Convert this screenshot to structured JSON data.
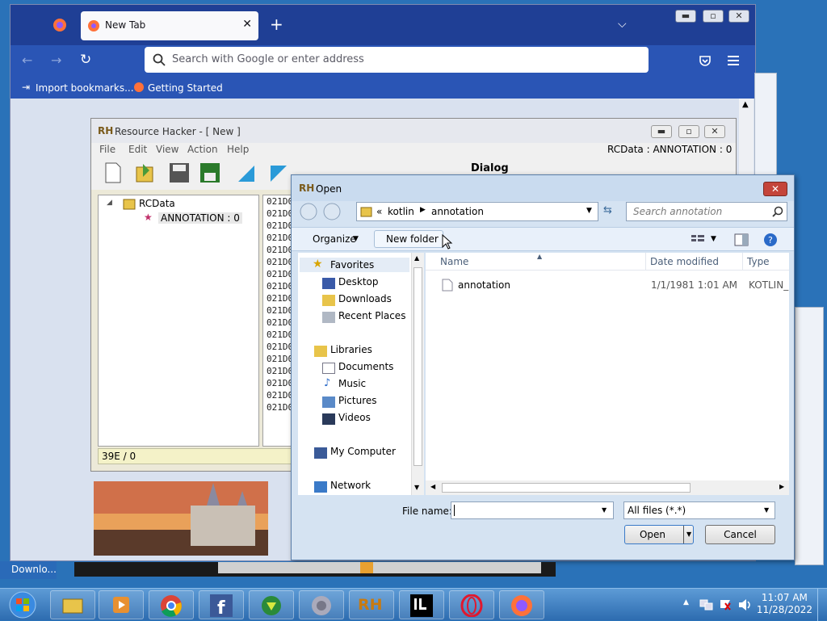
{
  "firefox": {
    "tab_title": "New Tab",
    "tab_close": "✕",
    "new_tab": "+",
    "url_placeholder": "Search with Google or enter address",
    "bookmarks": [
      "Import bookmarks...",
      "Getting Started"
    ]
  },
  "resource_hacker": {
    "title": "Resource Hacker - [ New ]",
    "menu": [
      "File",
      "Edit",
      "View",
      "Action",
      "Help"
    ],
    "status_right": "RCData : ANNOTATION : 0",
    "toolbar_dialog_label": "Dialog",
    "tree": {
      "root": "RCData",
      "child": "ANNOTATION : 0"
    },
    "hex_rows": [
      "021D0",
      "021D0",
      "021D0",
      "021D0",
      "021D0",
      "021D0",
      "021D0",
      "021D0",
      "021D0",
      "021D0",
      "021D0",
      "021D0",
      "021D0",
      "021D0",
      "021D0",
      "021D0",
      "021D0",
      "021D0"
    ],
    "status": "39E / 0"
  },
  "open_dialog": {
    "title": "Open",
    "breadcrumb": [
      "«",
      "kotlin",
      "annotation"
    ],
    "search_placeholder": "Search annotation",
    "organize": "Organize",
    "new_folder": "New folder",
    "nav": {
      "favorites": "Favorites",
      "favorites_items": [
        "Desktop",
        "Downloads",
        "Recent Places"
      ],
      "libraries": "Libraries",
      "libraries_items": [
        "Documents",
        "Music",
        "Pictures",
        "Videos"
      ],
      "computer": "My Computer",
      "network": "Network"
    },
    "columns": [
      "Name",
      "Date modified",
      "Type"
    ],
    "files": [
      {
        "name": "annotation",
        "date": "1/1/1981 1:01 AM",
        "type": "KOTLIN_E"
      }
    ],
    "file_name_label": "File name:",
    "file_name_value": "",
    "filter": "All files (*.*)",
    "open_btn": "Open",
    "cancel_btn": "Cancel"
  },
  "desktop": {
    "download_label": "Downlo..."
  },
  "taskbar": {
    "time": "11:07 AM",
    "date": "11/28/2022"
  },
  "colors": {
    "taskbar": "#2d6cb0",
    "ff_tabbar": "#1f3f95",
    "ff_nav": "#2a55b5"
  }
}
